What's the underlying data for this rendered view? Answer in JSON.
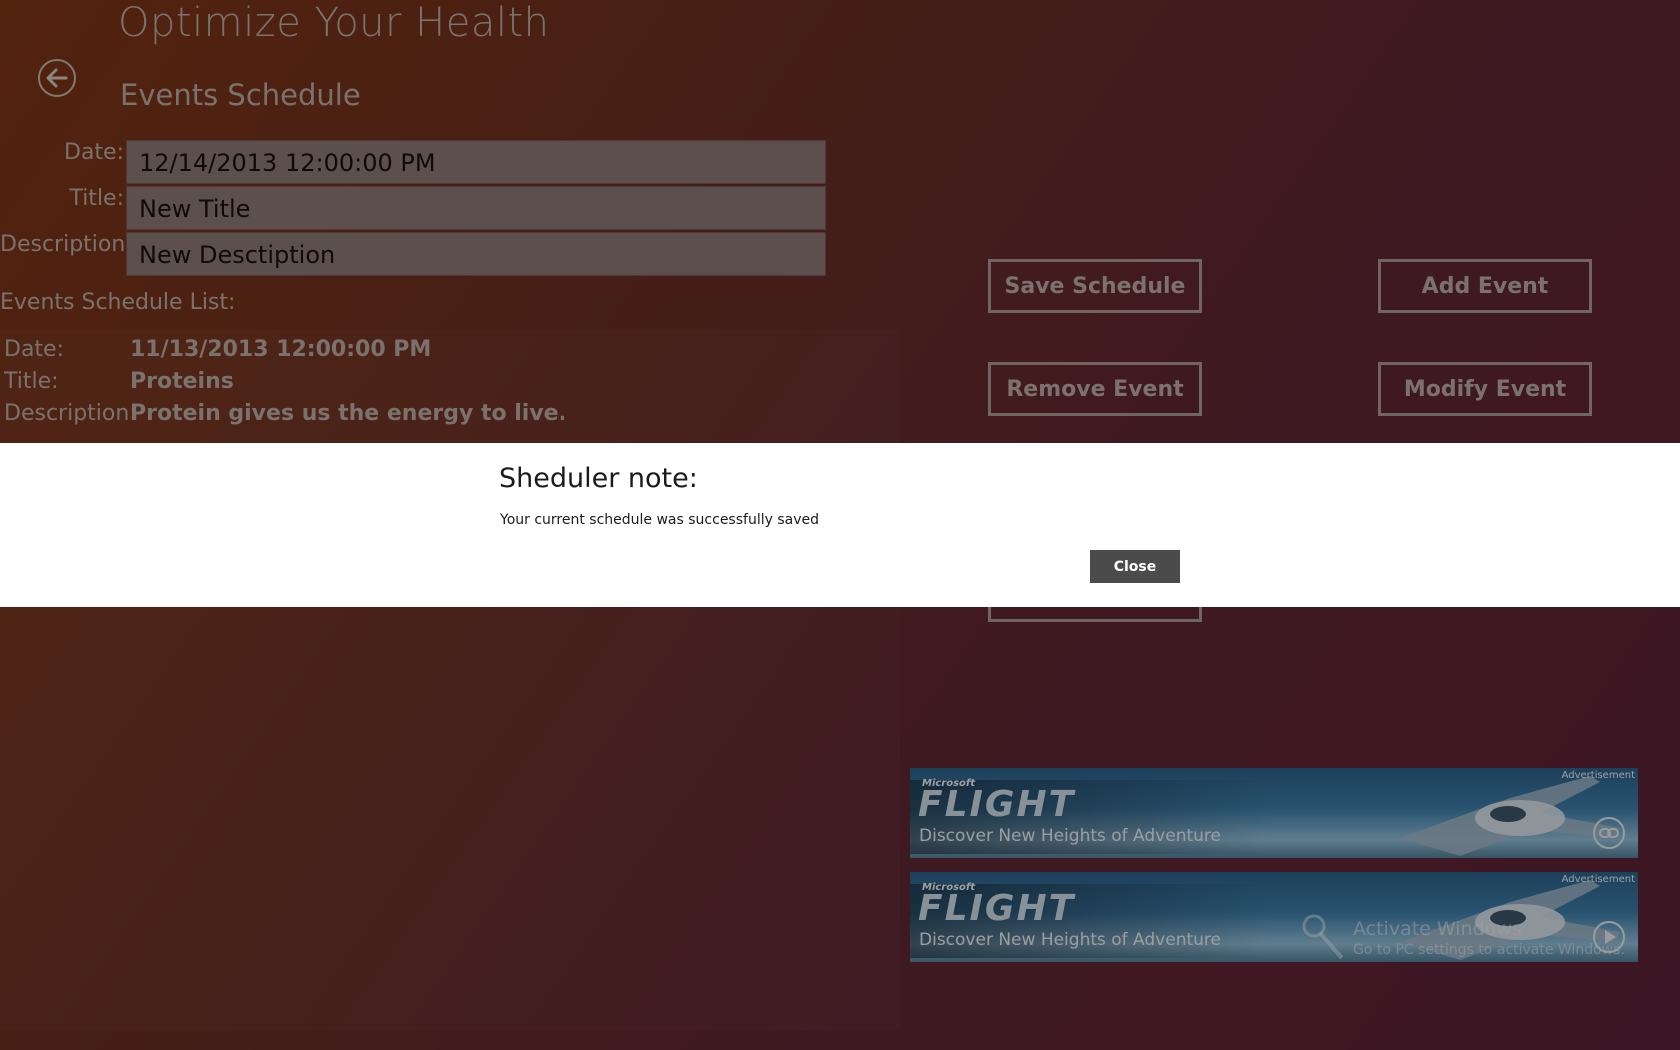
{
  "app": {
    "title": "Optimize Your Health"
  },
  "page": {
    "title": "Events Schedule"
  },
  "form": {
    "date_label": "Date:",
    "date_value": "12/14/2013 12:00:00 PM",
    "title_label": "Title:",
    "title_value": "New Title",
    "description_label": "Description:",
    "description_value": "New Desctiption"
  },
  "list": {
    "label": "Events Schedule List:",
    "items": [
      {
        "date_key": "Date:",
        "date": "11/13/2013 12:00:00 PM",
        "title_key": "Title:",
        "title": "Proteins",
        "description_key": "Description:",
        "description": "Protein gives us the energy to live. Foc"
      }
    ]
  },
  "buttons": {
    "save_schedule": "Save Schedule",
    "add_event": "Add Event",
    "remove_event": "Remove Event",
    "modify_event": "Modify Event"
  },
  "dialog": {
    "title": "Sheduler note:",
    "message": "Your current schedule was successfully saved",
    "close_label": "Close"
  },
  "ads": [
    {
      "ms": "Microsoft",
      "brand": "FLIGHT",
      "tagline": "Discover New Heights of Adventure",
      "label": "Advertisement",
      "icon": "link-icon"
    },
    {
      "ms": "Microsoft",
      "brand": "FLIGHT",
      "tagline": "Discover New Heights of Adventure",
      "label": "Advertisement",
      "icon": "play-icon"
    }
  ],
  "watermark": {
    "title": "Activate Windows",
    "subtitle": "Go to PC settings to activate Windows."
  },
  "colors": {
    "accent": "#a7958f",
    "text": "#b5a9a3",
    "dialog_bg": "#ffffff",
    "close_bg": "#4b4b4b"
  }
}
